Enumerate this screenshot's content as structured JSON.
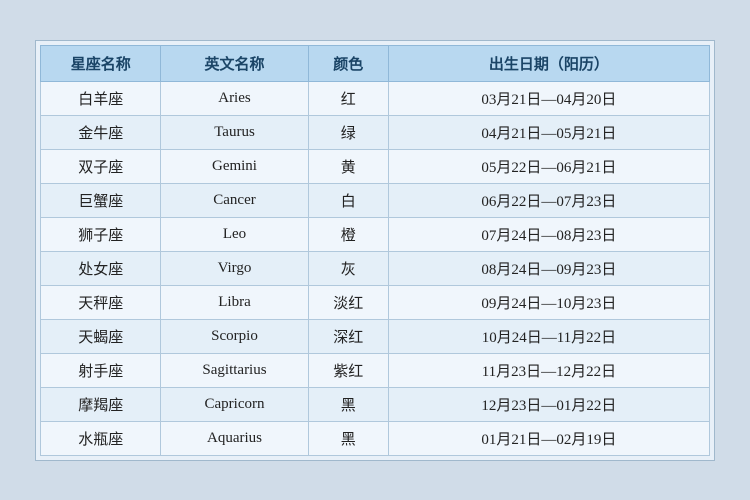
{
  "table": {
    "headers": [
      "星座名称",
      "英文名称",
      "颜色",
      "出生日期（阳历）"
    ],
    "rows": [
      {
        "cn": "白羊座",
        "en": "Aries",
        "color": "红",
        "date": "03月21日—04月20日"
      },
      {
        "cn": "金牛座",
        "en": "Taurus",
        "color": "绿",
        "date": "04月21日—05月21日"
      },
      {
        "cn": "双子座",
        "en": "Gemini",
        "color": "黄",
        "date": "05月22日—06月21日"
      },
      {
        "cn": "巨蟹座",
        "en": "Cancer",
        "color": "白",
        "date": "06月22日—07月23日"
      },
      {
        "cn": "狮子座",
        "en": "Leo",
        "color": "橙",
        "date": "07月24日—08月23日"
      },
      {
        "cn": "处女座",
        "en": "Virgo",
        "color": "灰",
        "date": "08月24日—09月23日"
      },
      {
        "cn": "天秤座",
        "en": "Libra",
        "color": "淡红",
        "date": "09月24日—10月23日"
      },
      {
        "cn": "天蝎座",
        "en": "Scorpio",
        "color": "深红",
        "date": "10月24日—11月22日"
      },
      {
        "cn": "射手座",
        "en": "Sagittarius",
        "color": "紫红",
        "date": "11月23日—12月22日"
      },
      {
        "cn": "摩羯座",
        "en": "Capricorn",
        "color": "黑",
        "date": "12月23日—01月22日"
      },
      {
        "cn": "水瓶座",
        "en": "Aquarius",
        "color": "黑",
        "date": "01月21日—02月19日"
      }
    ]
  }
}
